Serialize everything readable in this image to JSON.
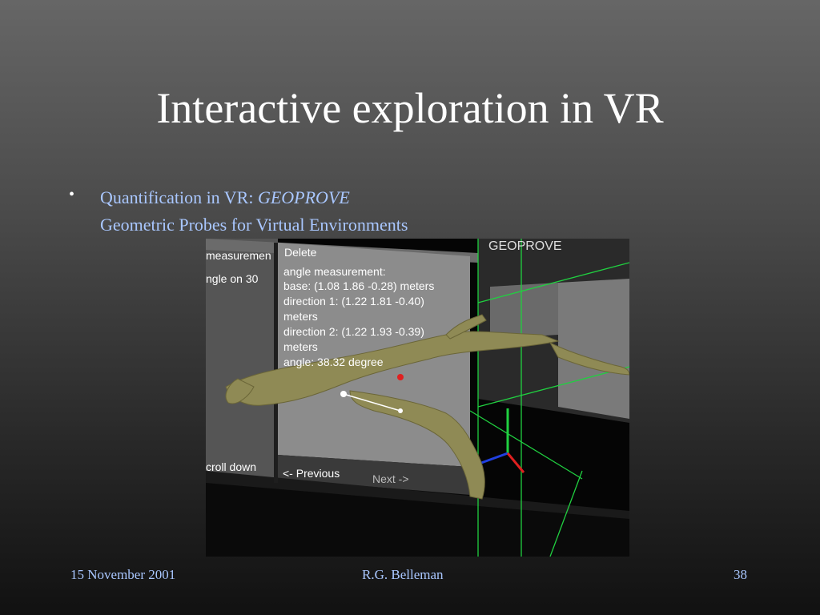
{
  "slide": {
    "title": "Interactive exploration in VR",
    "bullet_symbol": "•",
    "bullet_line1_prefix": "Quantification in VR: ",
    "bullet_line1_emph": "GEOPROVE",
    "bullet_line2": "Geometric Probes for Virtual Environments"
  },
  "vr_panel": {
    "left_panel_label": "measuremen",
    "left_panel_angle": "ngle on 30",
    "left_panel_scroll": "croll down",
    "delete_button": "Delete",
    "info_lines": [
      "angle measurement:",
      "base: (1.08 1.86 -0.28) meters",
      "direction 1: (1.22 1.81 -0.40)",
      "meters",
      "direction 2: (1.22 1.93 -0.39)",
      "meters",
      "angle: 38.32 degree"
    ],
    "previous_button": "<- Previous",
    "next_button": "Next ->",
    "geoprove_label": "GEOPROVE"
  },
  "colors": {
    "slide_title": "#ffffff",
    "bullet_text": "#a9c7ff",
    "panel_gray": "#8c8c8c",
    "vessel": "#8f8a55",
    "axis_x": "#e02020",
    "axis_y": "#20d040",
    "axis_z": "#2040e0"
  },
  "footer": {
    "date": "15 November 2001",
    "author": "R.G. Belleman",
    "page": "38"
  }
}
